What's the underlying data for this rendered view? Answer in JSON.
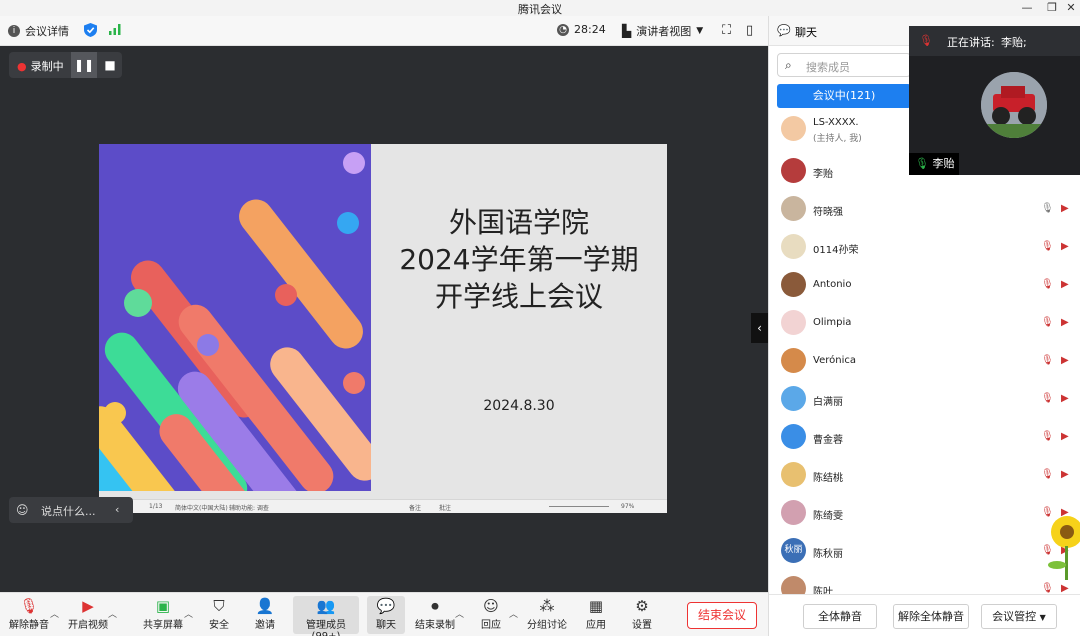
{
  "window": {
    "title": "腾讯会议"
  },
  "toolbar": {
    "meeting_details": "会议详情",
    "timer": "28:24",
    "speaker_view": "演讲者视图"
  },
  "recording": {
    "label": "录制中"
  },
  "slide": {
    "title_line1": "外国语学院",
    "title_line2": "2024学年第一学期",
    "title_line3": "开学线上会议",
    "date": "2024.8.30",
    "status_page": "1/13",
    "status_lang": "简体中文(中国大陆)",
    "status_access": "辅助功能: 调查",
    "status_notes": "备注",
    "status_comments": "批注",
    "status_zoom": "97%"
  },
  "chat_input": {
    "placeholder": "说点什么..."
  },
  "bottombar": {
    "unmute": "解除静音",
    "video": "开启视频",
    "share": "共享屏幕",
    "security": "安全",
    "invite": "邀请",
    "members": "管理成员(99+)",
    "chat": "聊天",
    "end_record": "结束录制",
    "reactions": "回应",
    "breakout": "分组讨论",
    "apps": "应用",
    "settings": "设置",
    "end_meeting": "结束会议"
  },
  "panel": {
    "tab_chat": "聊天",
    "search_placeholder": "搜索成员",
    "in_meeting": "会议中(121)",
    "members": [
      {
        "name": "LS-XXXX.",
        "sub": "(主持人, 我)"
      },
      {
        "name": "李贻",
        "sub": ""
      },
      {
        "name": "符晓强",
        "sub": ""
      },
      {
        "name": "0114孙荣",
        "sub": ""
      },
      {
        "name": "Antonio",
        "sub": ""
      },
      {
        "name": "Olimpia",
        "sub": ""
      },
      {
        "name": "Verónica",
        "sub": ""
      },
      {
        "name": "白满丽",
        "sub": ""
      },
      {
        "name": "曹金蓉",
        "sub": ""
      },
      {
        "name": "陈结桃",
        "sub": ""
      },
      {
        "name": "陈绮雯",
        "sub": ""
      },
      {
        "name": "陈秋丽",
        "sub": ""
      },
      {
        "name": "陈叶",
        "sub": ""
      }
    ],
    "avatar_text_chenqiuli": "秋丽",
    "footer": {
      "mute_all": "全体静音",
      "unmute_all": "解除全体静音",
      "controls": "会议管控"
    }
  },
  "speaker": {
    "label": "正在讲话:",
    "name": "李贻;",
    "tag": "李贻"
  }
}
